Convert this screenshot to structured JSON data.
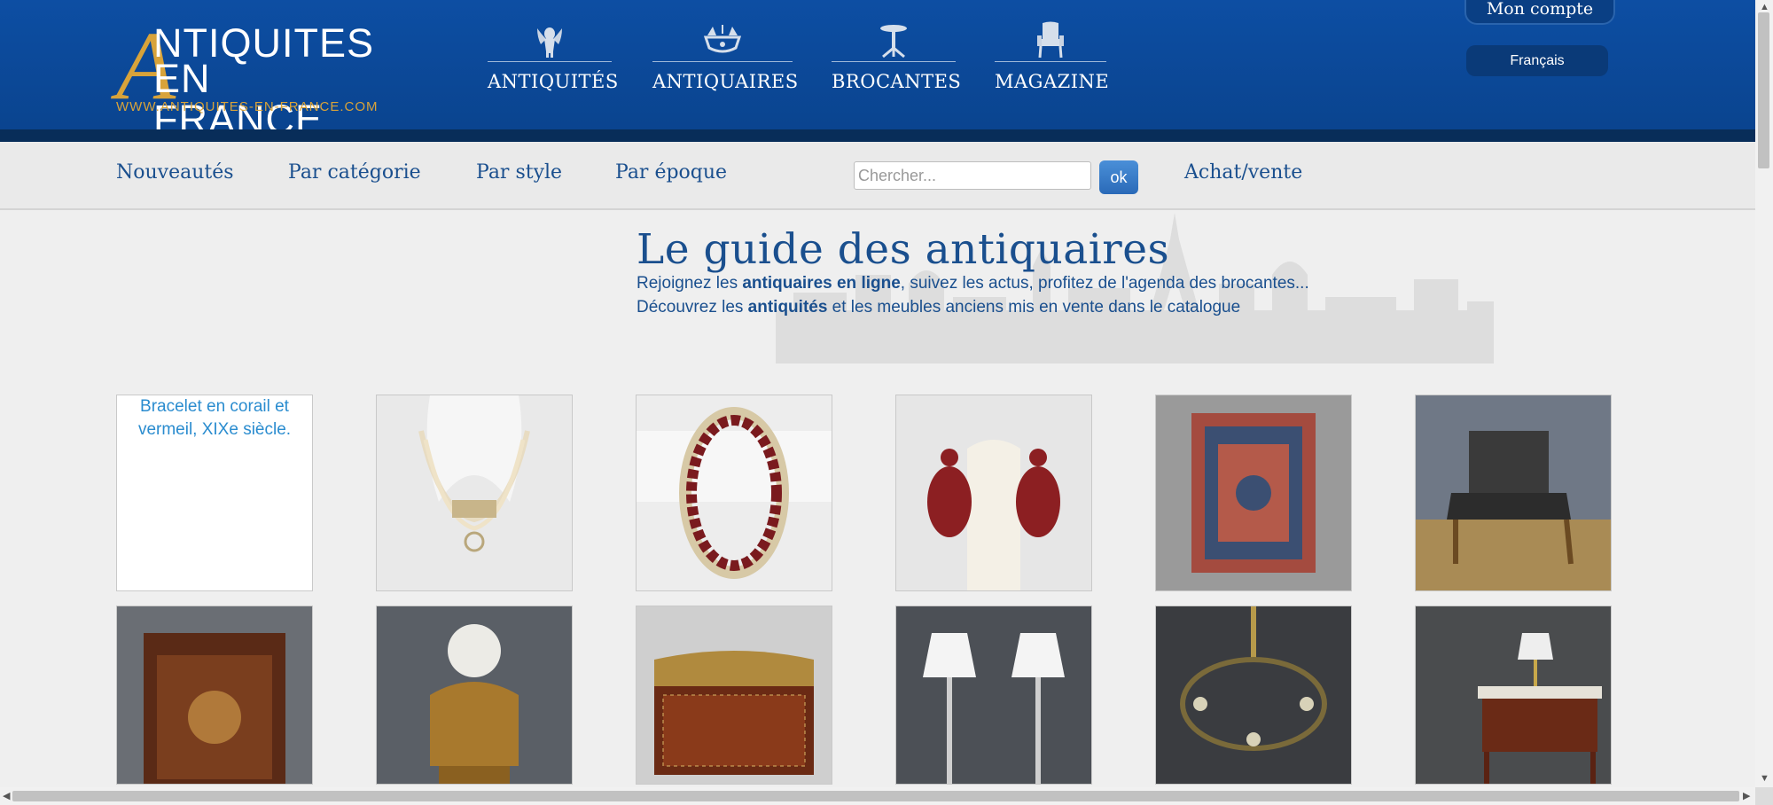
{
  "header": {
    "logo": {
      "big_letter": "A",
      "line1": "NTIQUITES",
      "line2": "EN FRANCE",
      "url": "WWW.ANTIQUITES-EN-FRANCE.COM"
    },
    "main_nav": [
      {
        "label": "ANTIQUITÉS",
        "icon": "cherub-icon"
      },
      {
        "label": "ANTIQUAIRES",
        "icon": "chandelier-icon"
      },
      {
        "label": "BROCANTES",
        "icon": "gueridon-table-icon"
      },
      {
        "label": "MAGAZINE",
        "icon": "armchair-icon"
      }
    ],
    "account_label": "Mon compte",
    "language_label": "Français"
  },
  "subnav": {
    "links": [
      "Nouveautés",
      "Par catégorie",
      "Par style",
      "Par époque"
    ],
    "search_placeholder": "Chercher...",
    "ok_label": "ok",
    "buy_sell_label": "Achat/vente"
  },
  "hero": {
    "title": "Le guide des antiquaires",
    "line1_pre": "Rejoignez les ",
    "line1_bold": "antiquaires en ligne",
    "line1_post": ", suivez les actus, profitez de l'agenda des brocantes...",
    "line2_pre": "Découvrez les ",
    "line2_bold": "antiquités",
    "line2_post": " et les meubles anciens mis en vente dans le catalogue"
  },
  "products": [
    {
      "alt": "Bracelet en corail et vermeil, XIXe siècle.",
      "kind": "broken-image"
    },
    {
      "kind": "pearl-necklace"
    },
    {
      "kind": "garnet-ring"
    },
    {
      "kind": "garnet-earrings"
    },
    {
      "kind": "persian-rug"
    },
    {
      "kind": "armchair"
    },
    {
      "kind": "marquetry-cabinet"
    },
    {
      "kind": "bronze-bust"
    },
    {
      "kind": "inlaid-box"
    },
    {
      "kind": "pair-of-lamps"
    },
    {
      "kind": "chandelier"
    },
    {
      "kind": "bedside-table"
    }
  ],
  "colors": {
    "header_blue": "#0d4ea3",
    "header_band": "#082d59",
    "logo_gold": "#d8a33a",
    "link_blue": "#1a4f8e",
    "alt_text_blue": "#2a8ccf"
  }
}
